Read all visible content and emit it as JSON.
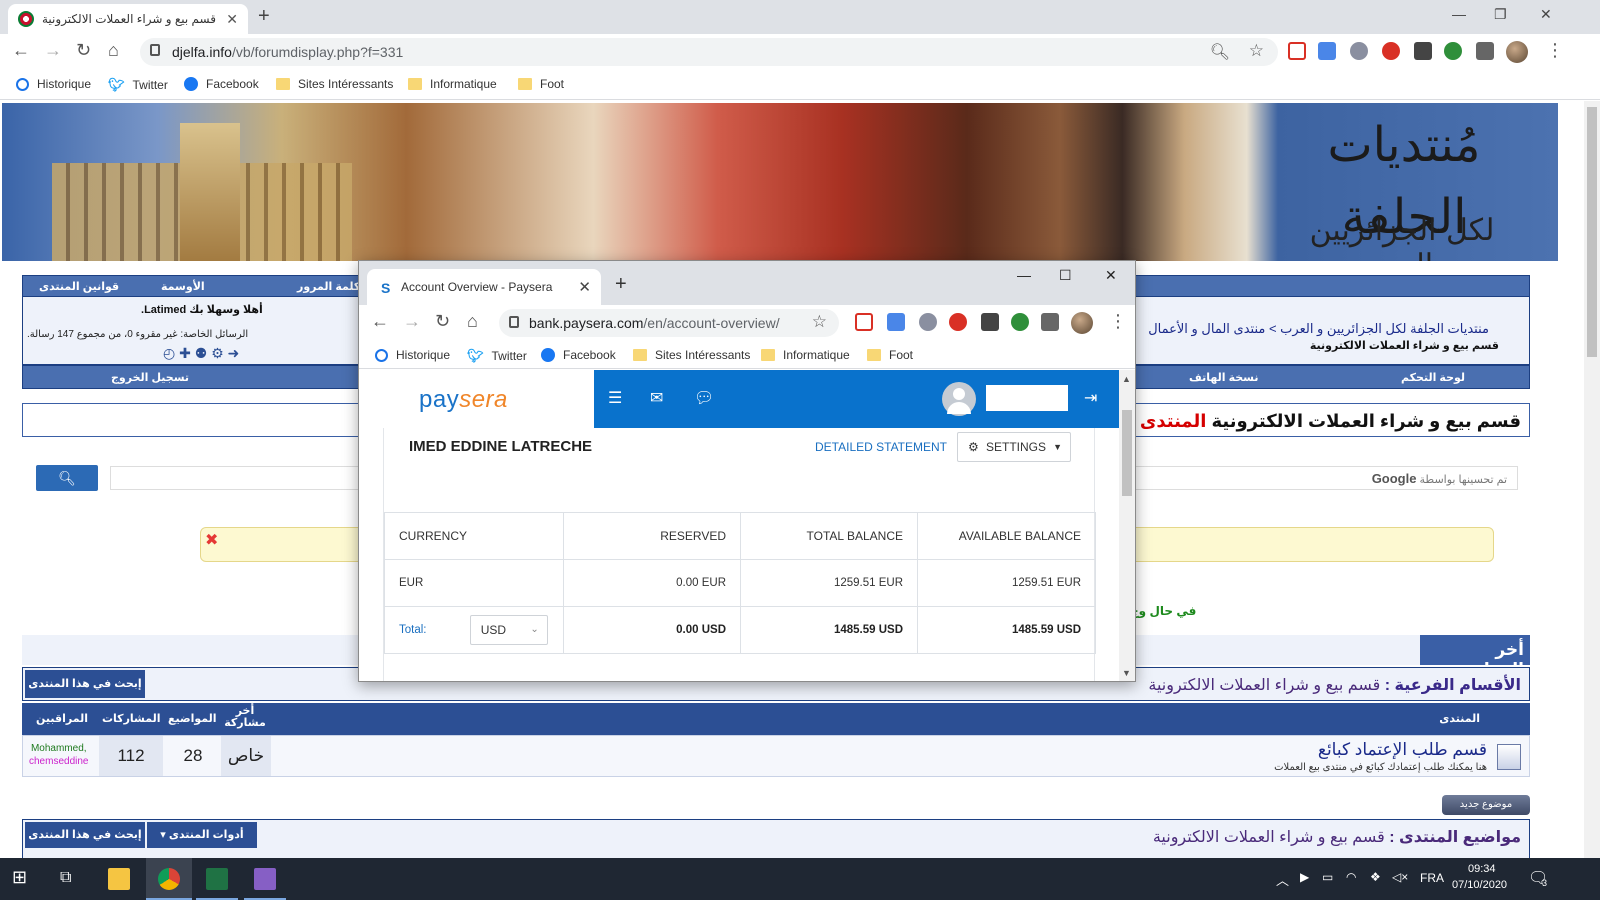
{
  "browser": {
    "tab_title": "قسم بيع و شراء العملات الالكترونية",
    "url_domain": "djelfa.info",
    "url_path": "/vb/forumdisplay.php?f=331",
    "bookmarks": [
      "Historique",
      "Twitter",
      "Facebook",
      "Sites Intéressants",
      "Informatique",
      "Foot"
    ]
  },
  "forum": {
    "nav_top": [
      "قوانين المنتدى",
      "الأوسمة",
      "كلمة المرور"
    ],
    "greeting": "أهلا وسهلا بك Latimed.",
    "pm_info": "الرسائل الخاصة: غير مقروء 0، من مجموع 147 رسالة.",
    "breadcrumb_1": "منتديات الجلفة لكل الجزائريين و العرب",
    "breadcrumb_sep": ">",
    "breadcrumb_2": "منتدى المال و الأعمال",
    "breadcrumb_current": "قسم بيع و شراء العملات الالكترونية",
    "nav_bottom_left": "تسجيل الخروج",
    "nav_bottom_mid": "نسخة الهاتف",
    "nav_bottom_right": "لوحة التحكم",
    "headline": "قسم بيع و شراء العملات الالكترونية",
    "headline_red": "المنتدى غير مسؤول",
    "search_powered": "تم تحسينها بواسطة",
    "search_google": "Google",
    "green_note": "في حال وج",
    "latest": "أخر المواضيع",
    "subforums_label": "الأقسام الفرعية :",
    "subforums_name": "قسم بيع و شراء العملات الالكترونية",
    "search_forum_btn": "إبحث في هذا المنتدى",
    "col_forum": "المنتدى",
    "col_last": "أخر مشاركة",
    "col_topics": "المواضيع",
    "col_posts": "المشاركات",
    "col_mods": "المراقبين",
    "row_title": "قسم طلب الإعتماد كبائع",
    "row_desc": "هنا يمكنك طلب إعتمادك كبائع في منتدى بيع العملات",
    "row_last": "خاص",
    "row_topics": "28",
    "row_posts": "112",
    "row_mod1": "Mohammed,",
    "row_mod2": "chemseddine",
    "new_topic": "موضوع جديد",
    "topics_label": "مواضيع المنتدى :",
    "topics_name": "قسم بيع و شراء العملات الالكترونية",
    "forum_tools": "أدوات المنتدى",
    "logo_main": "مُنتديات الجلفة",
    "logo_sub": "لكل الجزائريين والعرب"
  },
  "popup": {
    "tab_title": "Account Overview - Paysera",
    "url_domain": "bank.paysera.com",
    "url_path": "/en/account-overview/",
    "bookmarks": [
      "Historique",
      "Twitter",
      "Facebook",
      "Sites Intéressants",
      "Informatique",
      "Foot"
    ],
    "logo_a": "pay",
    "logo_b": "sera",
    "owner": "IMED EDDINE LATRECHE",
    "detailed": "DETAILED STATEMENT",
    "settings": "SETTINGS",
    "table": {
      "headers": [
        "CURRENCY",
        "RESERVED",
        "TOTAL BALANCE",
        "AVAILABLE BALANCE"
      ],
      "row": [
        "EUR",
        "0.00 EUR",
        "1259.51 EUR",
        "1259.51 EUR"
      ],
      "total_label": "Total:",
      "total_currency": "USD",
      "total_values": [
        "0.00 USD",
        "1485.59 USD",
        "1485.59 USD"
      ]
    }
  },
  "taskbar": {
    "lang": "FRA",
    "time": "09:34",
    "date": "07/10/2020",
    "notif_count": "3"
  }
}
